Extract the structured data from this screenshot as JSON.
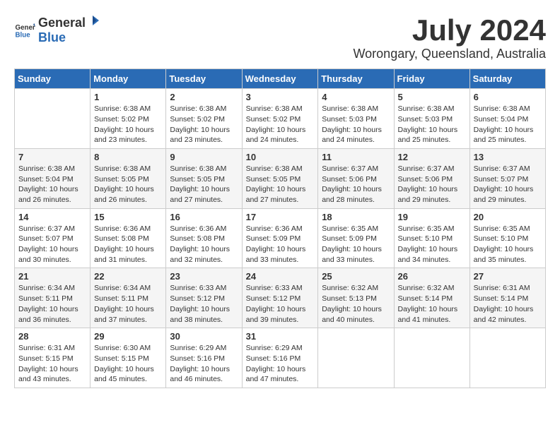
{
  "header": {
    "logo_general": "General",
    "logo_blue": "Blue",
    "title": "July 2024",
    "subtitle": "Worongary, Queensland, Australia"
  },
  "calendar": {
    "days_of_week": [
      "Sunday",
      "Monday",
      "Tuesday",
      "Wednesday",
      "Thursday",
      "Friday",
      "Saturday"
    ],
    "weeks": [
      [
        {
          "day": "",
          "info": ""
        },
        {
          "day": "1",
          "info": "Sunrise: 6:38 AM\nSunset: 5:02 PM\nDaylight: 10 hours\nand 23 minutes."
        },
        {
          "day": "2",
          "info": "Sunrise: 6:38 AM\nSunset: 5:02 PM\nDaylight: 10 hours\nand 23 minutes."
        },
        {
          "day": "3",
          "info": "Sunrise: 6:38 AM\nSunset: 5:02 PM\nDaylight: 10 hours\nand 24 minutes."
        },
        {
          "day": "4",
          "info": "Sunrise: 6:38 AM\nSunset: 5:03 PM\nDaylight: 10 hours\nand 24 minutes."
        },
        {
          "day": "5",
          "info": "Sunrise: 6:38 AM\nSunset: 5:03 PM\nDaylight: 10 hours\nand 25 minutes."
        },
        {
          "day": "6",
          "info": "Sunrise: 6:38 AM\nSunset: 5:04 PM\nDaylight: 10 hours\nand 25 minutes."
        }
      ],
      [
        {
          "day": "7",
          "info": "Sunrise: 6:38 AM\nSunset: 5:04 PM\nDaylight: 10 hours\nand 26 minutes."
        },
        {
          "day": "8",
          "info": "Sunrise: 6:38 AM\nSunset: 5:05 PM\nDaylight: 10 hours\nand 26 minutes."
        },
        {
          "day": "9",
          "info": "Sunrise: 6:38 AM\nSunset: 5:05 PM\nDaylight: 10 hours\nand 27 minutes."
        },
        {
          "day": "10",
          "info": "Sunrise: 6:38 AM\nSunset: 5:05 PM\nDaylight: 10 hours\nand 27 minutes."
        },
        {
          "day": "11",
          "info": "Sunrise: 6:37 AM\nSunset: 5:06 PM\nDaylight: 10 hours\nand 28 minutes."
        },
        {
          "day": "12",
          "info": "Sunrise: 6:37 AM\nSunset: 5:06 PM\nDaylight: 10 hours\nand 29 minutes."
        },
        {
          "day": "13",
          "info": "Sunrise: 6:37 AM\nSunset: 5:07 PM\nDaylight: 10 hours\nand 29 minutes."
        }
      ],
      [
        {
          "day": "14",
          "info": "Sunrise: 6:37 AM\nSunset: 5:07 PM\nDaylight: 10 hours\nand 30 minutes."
        },
        {
          "day": "15",
          "info": "Sunrise: 6:36 AM\nSunset: 5:08 PM\nDaylight: 10 hours\nand 31 minutes."
        },
        {
          "day": "16",
          "info": "Sunrise: 6:36 AM\nSunset: 5:08 PM\nDaylight: 10 hours\nand 32 minutes."
        },
        {
          "day": "17",
          "info": "Sunrise: 6:36 AM\nSunset: 5:09 PM\nDaylight: 10 hours\nand 33 minutes."
        },
        {
          "day": "18",
          "info": "Sunrise: 6:35 AM\nSunset: 5:09 PM\nDaylight: 10 hours\nand 33 minutes."
        },
        {
          "day": "19",
          "info": "Sunrise: 6:35 AM\nSunset: 5:10 PM\nDaylight: 10 hours\nand 34 minutes."
        },
        {
          "day": "20",
          "info": "Sunrise: 6:35 AM\nSunset: 5:10 PM\nDaylight: 10 hours\nand 35 minutes."
        }
      ],
      [
        {
          "day": "21",
          "info": "Sunrise: 6:34 AM\nSunset: 5:11 PM\nDaylight: 10 hours\nand 36 minutes."
        },
        {
          "day": "22",
          "info": "Sunrise: 6:34 AM\nSunset: 5:11 PM\nDaylight: 10 hours\nand 37 minutes."
        },
        {
          "day": "23",
          "info": "Sunrise: 6:33 AM\nSunset: 5:12 PM\nDaylight: 10 hours\nand 38 minutes."
        },
        {
          "day": "24",
          "info": "Sunrise: 6:33 AM\nSunset: 5:12 PM\nDaylight: 10 hours\nand 39 minutes."
        },
        {
          "day": "25",
          "info": "Sunrise: 6:32 AM\nSunset: 5:13 PM\nDaylight: 10 hours\nand 40 minutes."
        },
        {
          "day": "26",
          "info": "Sunrise: 6:32 AM\nSunset: 5:14 PM\nDaylight: 10 hours\nand 41 minutes."
        },
        {
          "day": "27",
          "info": "Sunrise: 6:31 AM\nSunset: 5:14 PM\nDaylight: 10 hours\nand 42 minutes."
        }
      ],
      [
        {
          "day": "28",
          "info": "Sunrise: 6:31 AM\nSunset: 5:15 PM\nDaylight: 10 hours\nand 43 minutes."
        },
        {
          "day": "29",
          "info": "Sunrise: 6:30 AM\nSunset: 5:15 PM\nDaylight: 10 hours\nand 45 minutes."
        },
        {
          "day": "30",
          "info": "Sunrise: 6:29 AM\nSunset: 5:16 PM\nDaylight: 10 hours\nand 46 minutes."
        },
        {
          "day": "31",
          "info": "Sunrise: 6:29 AM\nSunset: 5:16 PM\nDaylight: 10 hours\nand 47 minutes."
        },
        {
          "day": "",
          "info": ""
        },
        {
          "day": "",
          "info": ""
        },
        {
          "day": "",
          "info": ""
        }
      ]
    ]
  }
}
